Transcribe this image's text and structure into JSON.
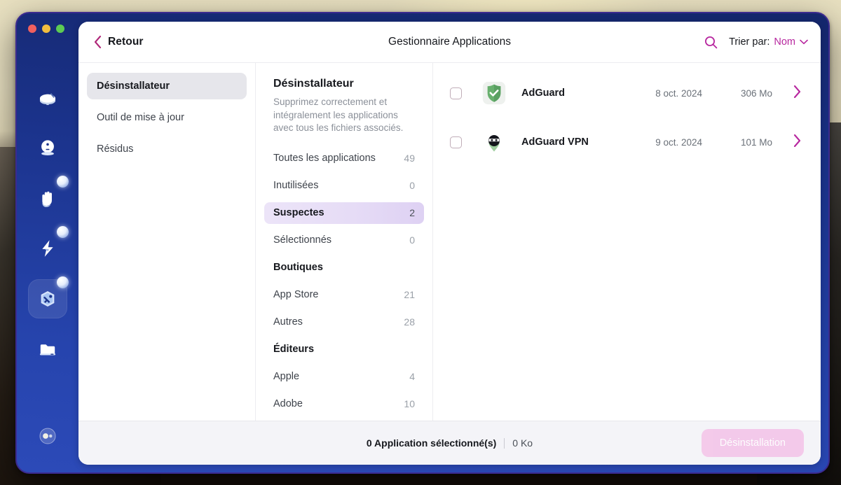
{
  "window": {
    "title": "Gestionnaire Applications",
    "back_label": "Retour",
    "traffic_lights": [
      "close-button",
      "minimize-button",
      "maximize-button"
    ],
    "accent_color": "#b7279f",
    "window_border_color": "#3b2a8f",
    "dock_background": "#1b338c"
  },
  "titlebar": {
    "search_icon": "search-icon",
    "sort_label": "Trier par:",
    "sort_value": "Nom",
    "sort_chevron": "chevron-down-icon"
  },
  "nav": {
    "items": [
      {
        "label": "Désinstallateur",
        "active": true,
        "name": "sidebar-item-uninstaller"
      },
      {
        "label": "Outil de mise à jour",
        "active": false,
        "name": "sidebar-item-updater"
      },
      {
        "label": "Résidus",
        "active": false,
        "name": "sidebar-item-leftovers"
      }
    ]
  },
  "filters": {
    "title": "Désinstallateur",
    "description": "Supprimez correctement et intégralement les applications avec tous les fichiers associés.",
    "rows": [
      {
        "label": "Toutes les applications",
        "count": "49",
        "type": "item",
        "selected": false,
        "name": "filter-all-applications"
      },
      {
        "label": "Inutilisées",
        "count": "0",
        "type": "item",
        "selected": false,
        "name": "filter-unused"
      },
      {
        "label": "Suspectes",
        "count": "2",
        "type": "item",
        "selected": true,
        "name": "filter-suspicious"
      },
      {
        "label": "Sélectionnés",
        "count": "0",
        "type": "item",
        "selected": false,
        "name": "filter-selected"
      },
      {
        "label": "Boutiques",
        "count": "",
        "type": "group",
        "selected": false,
        "name": "filter-group-stores"
      },
      {
        "label": "App Store",
        "count": "21",
        "type": "item",
        "selected": false,
        "name": "filter-app-store"
      },
      {
        "label": "Autres",
        "count": "28",
        "type": "item",
        "selected": false,
        "name": "filter-others"
      },
      {
        "label": "Éditeurs",
        "count": "",
        "type": "group",
        "selected": false,
        "name": "filter-group-vendors"
      },
      {
        "label": "Apple",
        "count": "4",
        "type": "item",
        "selected": false,
        "name": "filter-apple"
      },
      {
        "label": "Adobe",
        "count": "10",
        "type": "item",
        "selected": false,
        "name": "filter-adobe"
      }
    ]
  },
  "apps": [
    {
      "name": "AdGuard",
      "date": "8 oct. 2024",
      "size": "306 Mo",
      "checked": false,
      "icon": "adguard-shield-icon"
    },
    {
      "name": "AdGuard VPN",
      "date": "9 oct. 2024",
      "size": "101 Mo",
      "checked": false,
      "icon": "adguard-vpn-ninja-icon"
    }
  ],
  "footer": {
    "status_count": "0 Application sélectionné(s)",
    "status_size": "0 Ko",
    "uninstall_label": "Désinstallation",
    "uninstall_disabled": true
  },
  "dock": {
    "items": [
      {
        "name": "dock-item-cleanup",
        "icon": "disk-broom-icon",
        "selected": false,
        "dot": false
      },
      {
        "name": "dock-item-smart-scan",
        "icon": "scan-face-icon",
        "selected": false,
        "dot": false
      },
      {
        "name": "dock-item-protection",
        "icon": "hand-icon",
        "selected": false,
        "dot": true
      },
      {
        "name": "dock-item-performance",
        "icon": "lightning-icon",
        "selected": false,
        "dot": true
      },
      {
        "name": "dock-item-applications",
        "icon": "hexagon-tools-icon",
        "selected": true,
        "dot": true
      },
      {
        "name": "dock-item-files",
        "icon": "folder-icon",
        "selected": false,
        "dot": false
      },
      {
        "name": "dock-item-account",
        "icon": "orb-icon",
        "selected": false,
        "dot": false
      }
    ]
  }
}
